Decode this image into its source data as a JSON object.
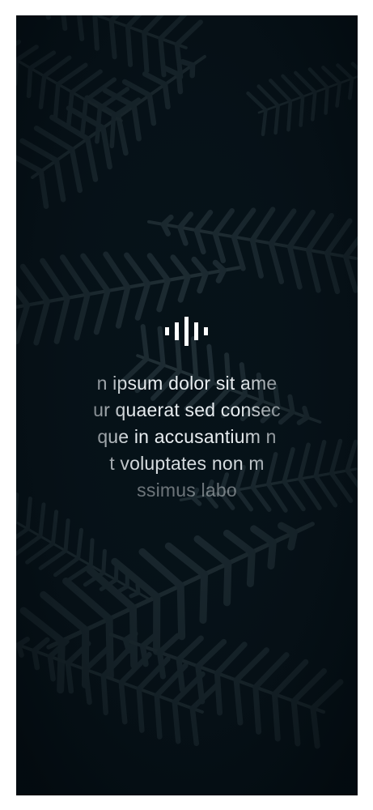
{
  "splash": {
    "background_color": "#061118",
    "fern_color": "#2a3a40",
    "logo_icon": "sound-wave-icon",
    "logo_color": "#ffffff",
    "quote_lines": [
      "n ipsum dolor sit ame",
      "ur quaerat sed consec",
      "que in accusantium n",
      "t voluptates non m",
      "ssimus labo"
    ]
  }
}
